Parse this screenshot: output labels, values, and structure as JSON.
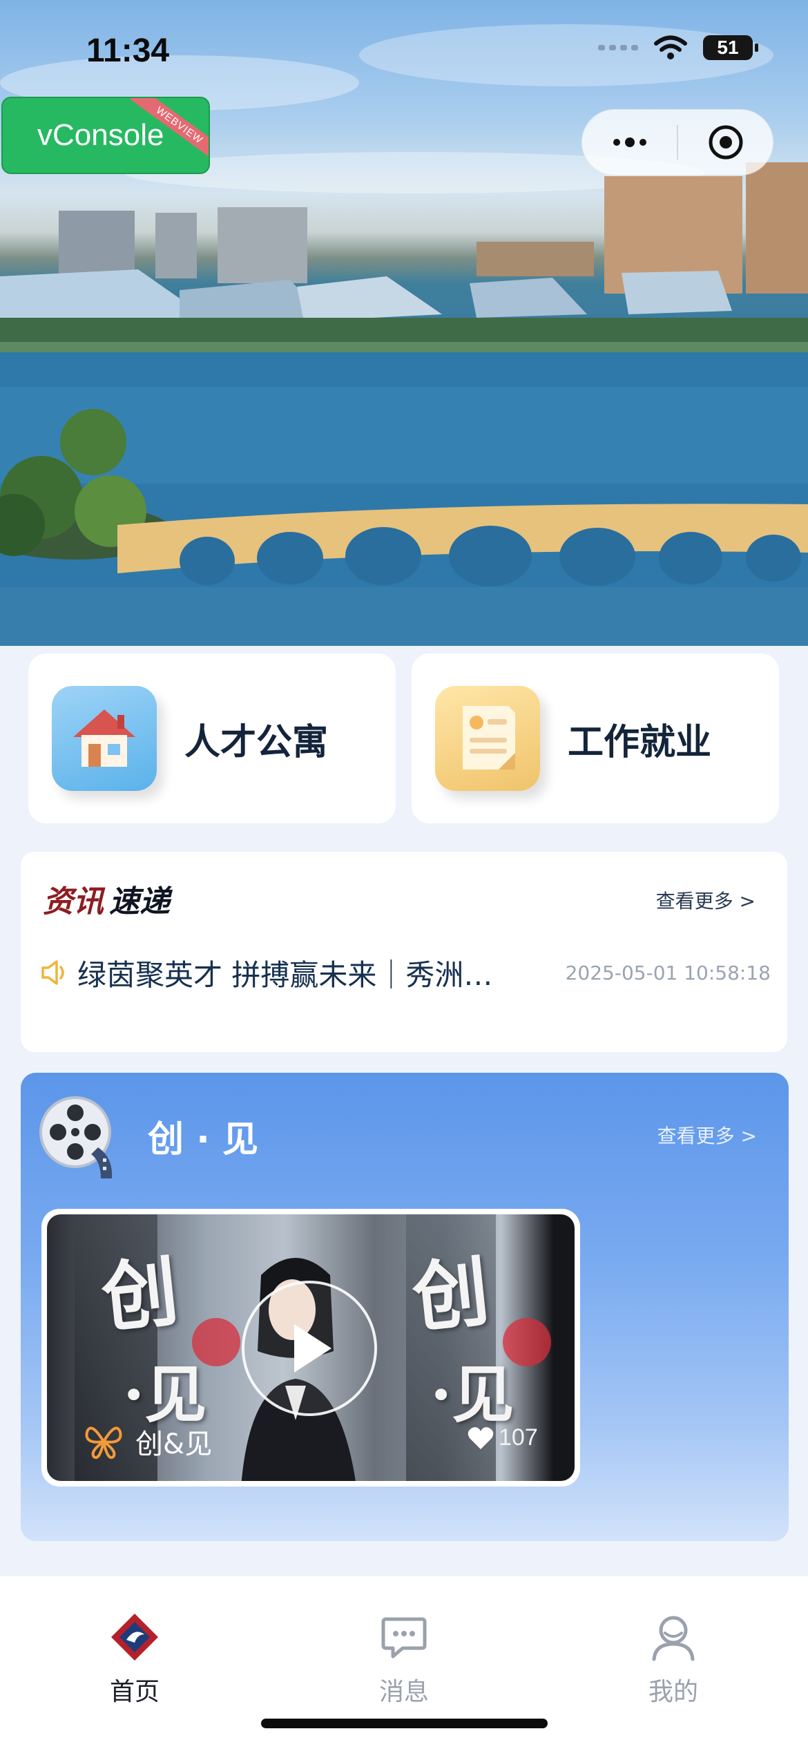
{
  "status_bar": {
    "time": "11:34",
    "battery": "51"
  },
  "vconsole": {
    "label": "vConsole",
    "ribbon": "WEBVIEW"
  },
  "quick_entries": [
    {
      "label": "人才公寓",
      "icon": "house-icon"
    },
    {
      "label": "工作就业",
      "icon": "document-icon"
    }
  ],
  "news": {
    "title_part1": "资讯",
    "title_part2": "速递",
    "more": "查看更多 >",
    "items": [
      {
        "text": "绿茵聚英才 拼搏赢未来｜秀洲…",
        "time": "2025-05-01 10:58:18"
      }
    ]
  },
  "cj_section": {
    "title": "创 · 见",
    "more": "查看更多 >",
    "video": {
      "brand": "创&见",
      "likes": "107",
      "cover_text_1": "创",
      "cover_text_2": "·见"
    }
  },
  "tabbar": {
    "items": [
      {
        "label": "首页",
        "active": true
      },
      {
        "label": "消息",
        "active": false
      },
      {
        "label": "我的",
        "active": false
      }
    ]
  },
  "colors": {
    "news_title_accent": "#8d1d22",
    "vconsole_green": "#26b961",
    "section_blue": "#5c96ea"
  }
}
